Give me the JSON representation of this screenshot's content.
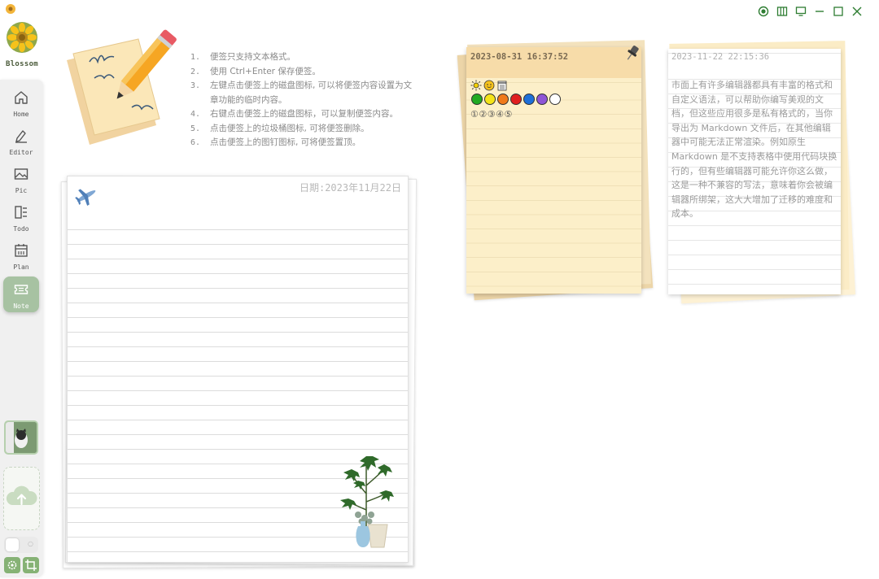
{
  "app": {
    "name": "Blossom"
  },
  "window_controls": [
    "record-icon",
    "columns-icon",
    "monitor-icon",
    "minimize-icon",
    "maximize-icon",
    "close-icon"
  ],
  "sidebar": {
    "items": [
      {
        "label": "Home",
        "icon": "home-icon",
        "active": false
      },
      {
        "label": "Editor",
        "icon": "pen-icon",
        "active": false
      },
      {
        "label": "Pic",
        "icon": "image-icon",
        "active": false
      },
      {
        "label": "Todo",
        "icon": "todo-icon",
        "active": false
      },
      {
        "label": "Plan",
        "icon": "calendar-icon",
        "active": false
      },
      {
        "label": "Note",
        "icon": "ticket-icon",
        "active": true
      }
    ],
    "toggle_text": "○"
  },
  "instructions": [
    {
      "num": "1.",
      "text": "便签只支持文本格式。"
    },
    {
      "num": "2.",
      "text": "使用 Ctrl+Enter 保存便签。"
    },
    {
      "num": "3.",
      "text": "左键点击便签上的磁盘图标, 可以将便签内容设置为文章功能的临时内容。"
    },
    {
      "num": "4.",
      "text": "右键点击便签上的磁盘图标，可以复制便签内容。"
    },
    {
      "num": "5.",
      "text": "点击便签上的垃圾桶图标, 可将便签删除。"
    },
    {
      "num": "6.",
      "text": "点击便签上的图钉图标, 可将便签置顶。"
    }
  ],
  "main_note": {
    "date": "日期:2023年11月22日"
  },
  "sticky1": {
    "time": "2023-08-31 16:37:52",
    "dots": [
      "#22aa22",
      "#f5e419",
      "#f07a1a",
      "#e01e1e",
      "#1e6fd8",
      "#8e55d6",
      "#ffffff"
    ],
    "circled": "①②③④⑤"
  },
  "sticky2": {
    "time": "2023-11-22 22:15:36",
    "body": "市面上有许多编辑器都具有丰富的格式和自定义语法，可以帮助你编写美观的文档，但这些应用很多是私有格式的，当你导出为 Markdown 文件后，在其他编辑器中可能无法正常渲染。例如原生 Markdown 是不支持表格中使用代码块换行的，但有些编辑器可能允许你这么做，这是一种不兼容的写法，意味着你会被编辑器所绑架，这大大增加了迁移的难度和成本。"
  }
}
